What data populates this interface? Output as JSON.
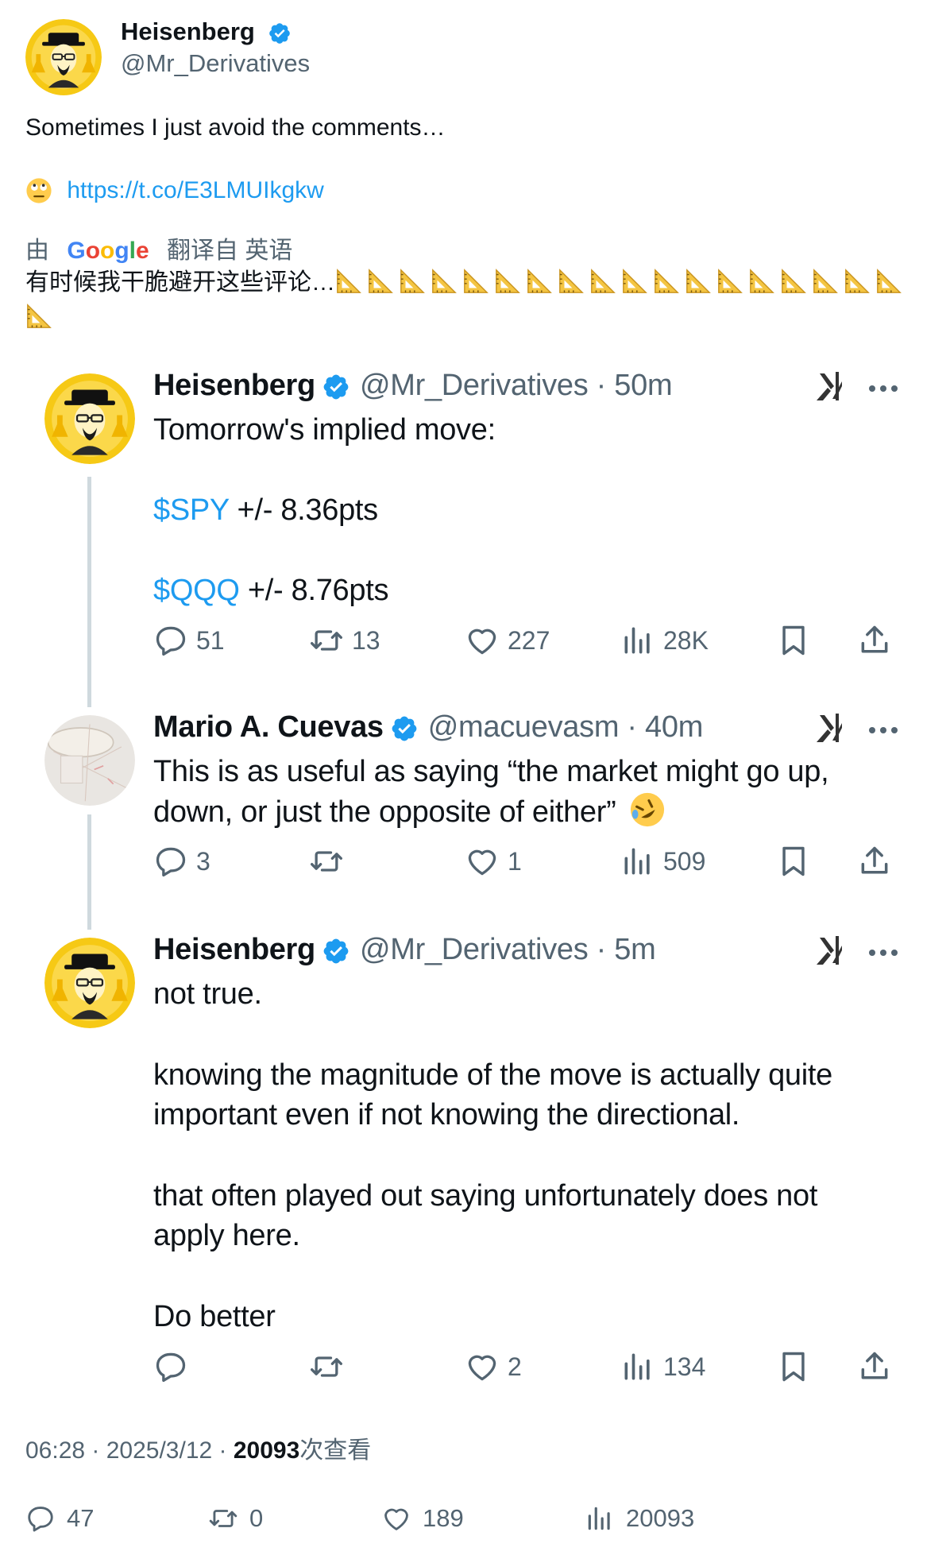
{
  "header": {
    "display_name": "Heisenberg",
    "handle": "@Mr_Derivatives",
    "verified": true
  },
  "post": {
    "text": "Sometimes I just avoid the comments…",
    "link": "https://t.co/E3LMUIkgkw",
    "link_emoji": "face-with-rolling-eyes",
    "translate_prefix": "由",
    "translate_provider": "Google",
    "translate_suffix": "翻译自 英语",
    "translated_text": "有时候我干脆避开这些评论…",
    "translated_emoji": "triangular-ruler",
    "translated_emoji_count": 19
  },
  "thread": [
    {
      "name": "Heisenberg",
      "handle_time": "@Mr_Derivatives · 50m",
      "lines": [
        "Tomorrow's implied move:",
        "",
        "$SPY +/- 8.36pts",
        "",
        "$QQQ +/- 8.76pts"
      ],
      "cashtags": [
        "$SPY",
        "$QQQ"
      ],
      "spy_rest": " +/- 8.36pts",
      "qqq_rest": " +/- 8.76pts",
      "replies": "51",
      "reposts": "13",
      "likes": "227",
      "views": "28K"
    },
    {
      "name": "Mario A. Cuevas",
      "handle_time": "@macuevasm · 40m",
      "text_line1": "This is as useful as saying “the market might go up,",
      "text_line2": "down, or just the opposite of either”",
      "text_emoji": "rolling-on-floor-laughing",
      "replies": "3",
      "reposts": "",
      "likes": "1",
      "views": "509"
    },
    {
      "name": "Heisenberg",
      "handle_time": "@Mr_Derivatives · 5m",
      "para1": "not true.",
      "para2_l1": "knowing the magnitude of the move is actually quite",
      "para2_l2": "important even if not knowing the directional.",
      "para3_l1": "that often played out saying unfortunately does not",
      "para3_l2": "apply here.",
      "para4": "Do better",
      "replies": "",
      "reposts": "",
      "likes": "2",
      "views": "134"
    }
  ],
  "footer": {
    "time": "06:28 · 2025/3/12 · ",
    "views": "20093",
    "views_label": "次查看",
    "replies": "47",
    "reposts": "0",
    "likes": "189",
    "views_count": "20093"
  },
  "colors": {
    "accent": "#1d9bf0",
    "secondary_text": "#536471",
    "primary_text": "#0f1419",
    "thread_line": "#cfd9de"
  }
}
